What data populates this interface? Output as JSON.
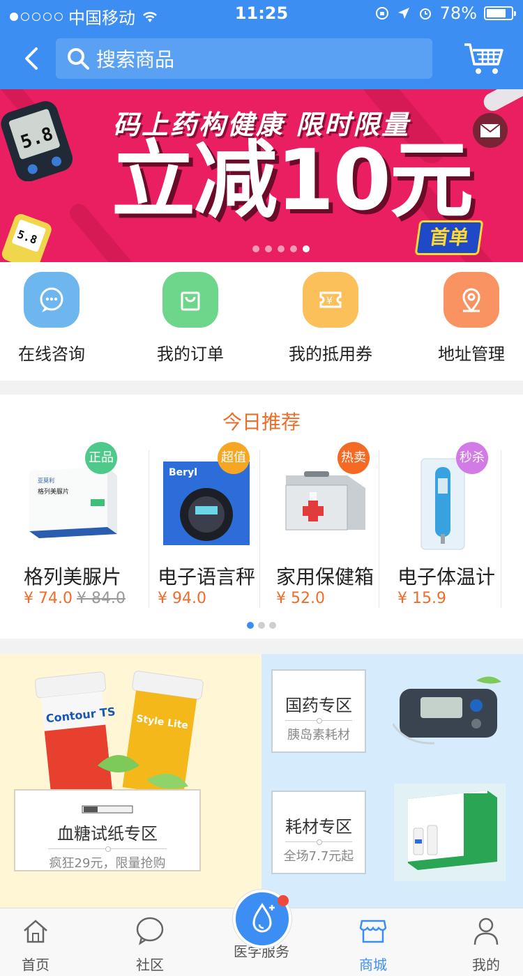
{
  "status_bar": {
    "carrier": "中国移动",
    "time": "11:25",
    "battery": "78%"
  },
  "header": {
    "search_placeholder": "搜索商品"
  },
  "banner": {
    "subtitle": "码上药构健康 限时限量",
    "headline": "立减10元",
    "badge": "首单",
    "slide_count": 5,
    "active_slide": 5
  },
  "quick_actions": [
    {
      "label": "在线咨询",
      "icon": "chat-icon",
      "color": "#6db7ee"
    },
    {
      "label": "我的订单",
      "icon": "shopping-bag-icon",
      "color": "#6dd68b"
    },
    {
      "label": "我的抵用券",
      "icon": "coupon-icon",
      "color": "#fbc05a"
    },
    {
      "label": "地址管理",
      "icon": "location-pin-icon",
      "color": "#f99462"
    }
  ],
  "recommend": {
    "title": "今日推荐",
    "products": [
      {
        "name": "格列美脲片",
        "price": "¥ 74.0",
        "old_price": "¥ 84.0",
        "tag": "正品",
        "tag_color": "#4fc98a"
      },
      {
        "name": "电子语言秤",
        "price": "¥ 94.0",
        "old_price": "",
        "tag": "超值",
        "tag_color": "#f6a623"
      },
      {
        "name": "家用保健箱",
        "price": "¥ 52.0",
        "old_price": "",
        "tag": "热卖",
        "tag_color": "#f46a24"
      },
      {
        "name": "电子体温计",
        "price": "¥ 15.9",
        "old_price": "",
        "tag": "秒杀",
        "tag_color": "#d27ae6"
      }
    ],
    "page_count": 3,
    "active_page": 1
  },
  "zones": {
    "test_strips": {
      "title": "血糖试纸专区",
      "subtitle": "疯狂29元，限量抢购"
    },
    "national": {
      "title": "国药专区",
      "subtitle": "胰岛素耗材"
    },
    "consumables": {
      "title": "耗材专区",
      "subtitle": "全场7.7元起"
    }
  },
  "product_labels": {
    "glimepiride_box": "格列美脲片",
    "scale_box": "Beryl",
    "strip_tube_1": "Contour TS",
    "strip_tube_2": "Style Lite"
  },
  "tabbar": [
    {
      "label": "首页",
      "icon": "home-icon"
    },
    {
      "label": "社区",
      "icon": "chat-bubble-icon"
    },
    {
      "label": "医学服务",
      "icon": "drop-plus-icon"
    },
    {
      "label": "商城",
      "icon": "store-icon",
      "active": true
    },
    {
      "label": "我的",
      "icon": "user-icon"
    }
  ],
  "colors": {
    "primary": "#3d8ef2",
    "banner": "#ea1f61",
    "accent": "#ee6d2a"
  }
}
